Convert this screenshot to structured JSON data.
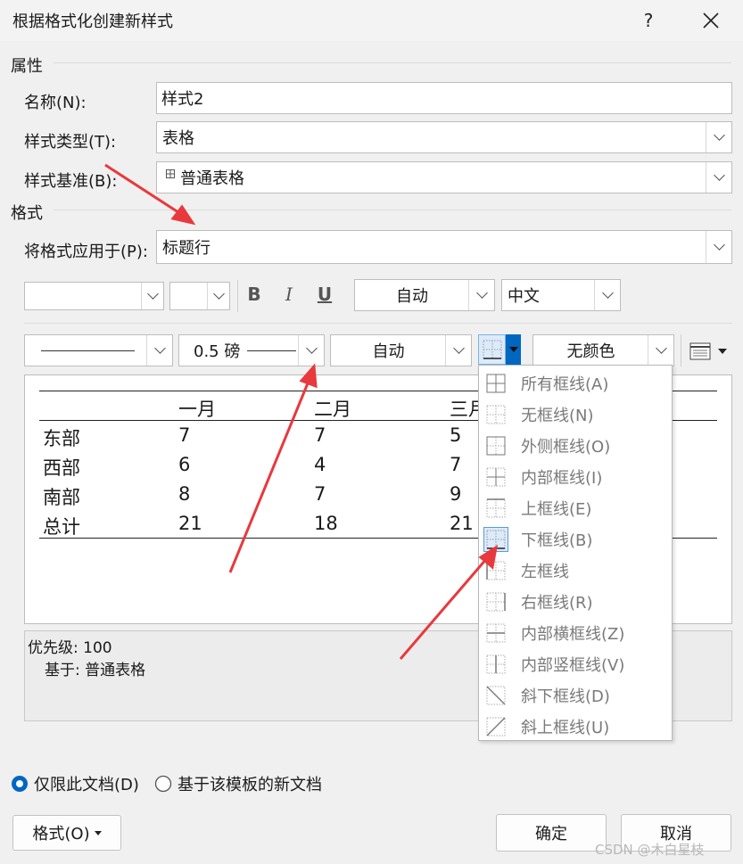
{
  "window": {
    "title": "根据格式化创建新样式",
    "help": "?",
    "close": "✕"
  },
  "properties": {
    "section": "属性",
    "name_label": "名称(N):",
    "name_value": "样式2",
    "type_label": "样式类型(T):",
    "type_value": "表格",
    "based_label": "样式基准(B):",
    "based_value": "普通表格"
  },
  "format": {
    "section": "格式",
    "apply_label": "将格式应用于(P):",
    "apply_value": "标题行",
    "font_name": "",
    "font_size": "",
    "bold": "B",
    "italic": "I",
    "underline": "U",
    "font_color": "自动",
    "script": "中文",
    "border_weight": "0.5 磅",
    "border_color": "自动",
    "shading": "无颜色"
  },
  "preview": {
    "headers": [
      "",
      "一月",
      "二月",
      "三月"
    ],
    "rows": [
      [
        "东部",
        "7",
        "7",
        "5"
      ],
      [
        "西部",
        "6",
        "4",
        "7"
      ],
      [
        "南部",
        "8",
        "7",
        "9"
      ],
      [
        "总计",
        "21",
        "18",
        "21"
      ]
    ]
  },
  "border_menu": {
    "items": [
      {
        "label": "所有框线(A)",
        "icon": "all-borders-icon"
      },
      {
        "label": "无框线(N)",
        "icon": "no-border-icon"
      },
      {
        "label": "外侧框线(O)",
        "icon": "outside-borders-icon"
      },
      {
        "label": "内部框线(I)",
        "icon": "inside-borders-icon"
      },
      {
        "label": "上框线(E)",
        "icon": "top-border-icon"
      },
      {
        "label": "下框线(B)",
        "icon": "bottom-border-icon"
      },
      {
        "label": "左框线",
        "icon": "left-border-icon"
      },
      {
        "label": "右框线(R)",
        "icon": "right-border-icon"
      },
      {
        "label": "内部横框线(Z)",
        "icon": "inside-horizontal-border-icon"
      },
      {
        "label": "内部竖框线(V)",
        "icon": "inside-vertical-border-icon"
      },
      {
        "label": "斜下框线(D)",
        "icon": "diagonal-down-border-icon"
      },
      {
        "label": "斜上框线(U)",
        "icon": "diagonal-up-border-icon"
      }
    ]
  },
  "description": {
    "priority": "优先级: 100",
    "based_on": "基于: 普通表格"
  },
  "scope": {
    "this_document": "仅限此文档(D)",
    "new_documents": "基于该模板的新文档"
  },
  "buttons": {
    "format": "格式(O)",
    "ok": "确定",
    "cancel": "取消"
  },
  "watermark": "CSDN @木白星枝",
  "colors": {
    "accent": "#0067c0",
    "arrow": "#e8393d"
  }
}
